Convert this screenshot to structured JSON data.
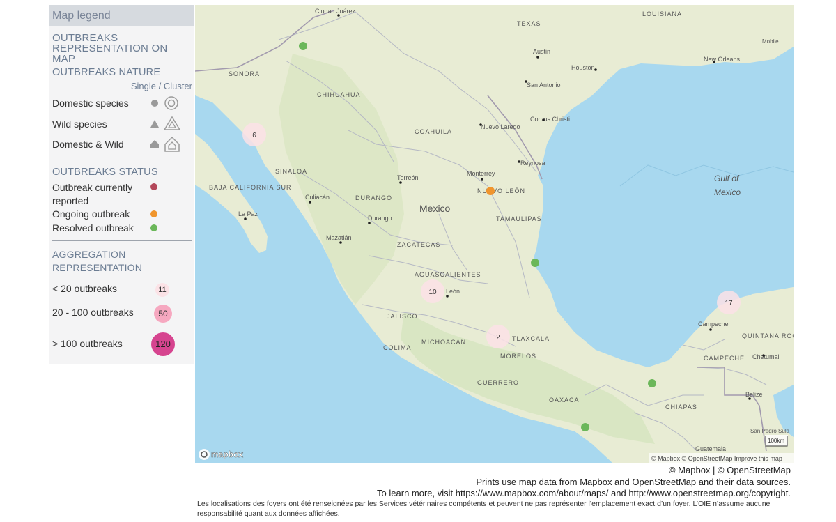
{
  "legend": {
    "title": "Map legend",
    "section_title": "OUTBREAKS REPRESENTATION ON MAP",
    "nature": {
      "heading": "OUTBREAKS NATURE",
      "subheading": "Single / Cluster",
      "items": [
        {
          "label": "Domestic species",
          "icon": "circle"
        },
        {
          "label": "Wild species",
          "icon": "triangle"
        },
        {
          "label": "Domestic & Wild",
          "icon": "house"
        }
      ]
    },
    "status": {
      "heading": "OUTBREAKS STATUS",
      "items": [
        {
          "label": "Outbreak currently reported",
          "color": "#b3475a"
        },
        {
          "label": "Ongoing outbreak",
          "color": "#f0952d"
        },
        {
          "label": "Resolved outbreak",
          "color": "#6bb75a"
        }
      ]
    },
    "aggregation": {
      "heading": "AGGREGATION REPRESENTATION",
      "items": [
        {
          "label": "< 20 outbreaks",
          "sample": "11",
          "color": "#fbe2e6"
        },
        {
          "label": "20 - 100 outbreaks",
          "sample": "50",
          "color": "#f6a8c0"
        },
        {
          "label": "> 100 outbreaks",
          "sample": "120",
          "color": "#d6448f"
        }
      ]
    }
  },
  "map": {
    "country_label": "Mexico",
    "gulf_label": "Gulf of Mexico",
    "region_labels": [
      "TEXAS",
      "LOUISIANA",
      "SONORA",
      "CHIHUAHUA",
      "COAHUILA",
      "SINALOA",
      "BAJA CALIFORNIA SUR",
      "DURANGO",
      "NUEVO LEÓN",
      "TAMAULIPAS",
      "ZACATECAS",
      "AGUASCALIENTES",
      "JALISCO",
      "COLIMA",
      "MICHOACAN",
      "TLAXCALA",
      "MORELOS",
      "GUERRERO",
      "OAXACA",
      "CHIAPAS",
      "CAMPECHE",
      "QUINTANA ROO"
    ],
    "city_labels": [
      "Ciudad Juárez",
      "Austin",
      "Houston",
      "New Orleans",
      "Mobile",
      "San Antonio",
      "Corpus Christi",
      "Nuevo Laredo",
      "Reynosa",
      "Monterrey",
      "Torreón",
      "Culiacán",
      "La Paz",
      "Durango",
      "Mazatlán",
      "León",
      "Campeche",
      "Chetumal",
      "Belize",
      "San Pedro Sula",
      "Guatemala"
    ],
    "clusters": [
      {
        "count": "6",
        "status": "aggregation"
      },
      {
        "count": "10",
        "status": "aggregation"
      },
      {
        "count": "2",
        "status": "aggregation"
      },
      {
        "count": "17",
        "status": "aggregation"
      }
    ],
    "single_outbreaks": [
      {
        "status": "resolved",
        "color": "#6bb75a"
      },
      {
        "status": "ongoing",
        "color": "#f0952d"
      },
      {
        "status": "resolved",
        "color": "#6bb75a"
      },
      {
        "status": "resolved",
        "color": "#6bb75a"
      },
      {
        "status": "resolved",
        "color": "#6bb75a"
      }
    ],
    "mapbox_logo": "mapbox",
    "scale_label": "100km",
    "attribution": "© Mapbox © OpenStreetMap  Improve this map"
  },
  "footer": {
    "credit": "© Mapbox | © OpenStreetMap",
    "prints": "Prints use map data from Mapbox and OpenStreetMap and their data sources.",
    "learn_more": "To learn more, visit https://www.mapbox.com/about/maps/ and http://www.openstreetmap.org/copyright.",
    "disclaimer": "Les localisations des foyers ont été renseignées par les Services vétérinaires compétents et peuvent ne pas représenter l’emplacement exact d’un foyer. L’OIE n’assume aucune responsabilité quant aux données affichées."
  }
}
